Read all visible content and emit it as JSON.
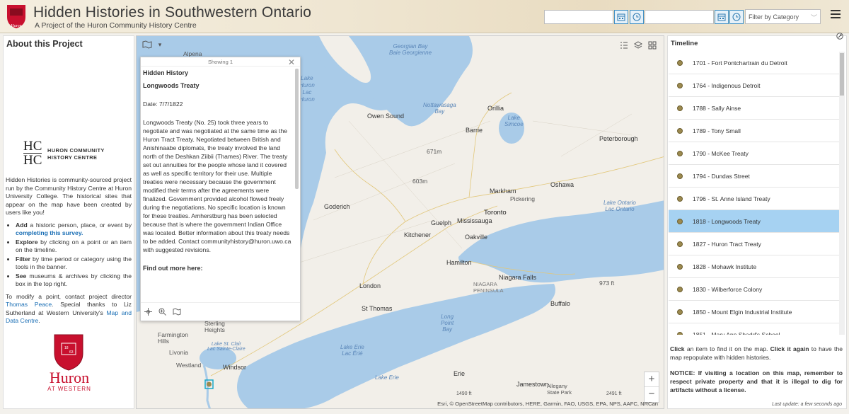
{
  "header": {
    "title": "Hidden Histories in Southwestern Ontario",
    "subtitle": "A Project of the Huron Community History Centre",
    "date_from_placeholder": "",
    "date_to_placeholder": "",
    "category_filter": "Filter by Category",
    "logo_text": "Huron",
    "accent": "#c8102e"
  },
  "about": {
    "title": "About this Project",
    "org_monogram_top": "HC",
    "org_monogram_bottom": "HC",
    "org_name_1": "HURON COMMUNITY",
    "org_name_2": "HISTORY CENTRE",
    "intro": "Hidden Histories is community-sourced project run by the Community History Centre at Huron University College. The historical sites that appear on the map have been created by users like you!",
    "bullets": [
      {
        "bold": "Add",
        "text": " a historic person, place, or event by ",
        "link": "completing this survey."
      },
      {
        "bold": "Explore",
        "text": " by clicking on a point or an item on the timeline.",
        "link": ""
      },
      {
        "bold": "Filter",
        "text": " by time period or category using the tools in the banner.",
        "link": ""
      },
      {
        "bold": "See",
        "text": " museums & archives by clicking the box in the top right.",
        "link": ""
      }
    ],
    "modify_pre": "To modify a point, contact project director ",
    "modify_link1": "Thomas Peace",
    "modify_mid": ". Special thanks to Liz Sutherland at Western University's ",
    "modify_link2": "Map and Data Centre",
    "modify_post": ".",
    "huron_word": "Huron",
    "at_western": "AT WESTERN",
    "shield_numbers": [
      "18",
      "63"
    ]
  },
  "popup": {
    "counter": "Showing 1",
    "layer_title": "Hidden History",
    "name": "Longwoods Treaty",
    "date_label": "Date:",
    "date_value": "7/7/1822",
    "description": "Longwoods Treaty (No. 25) took three years to negotiate and was negotiated at the same time as the Huron Tract Treaty. Negotiated between British and Anishinaabe diplomats, the treaty involved the land north of the Deshkan Ziibii (Thames) River. The treaty set out annuities for the people whose land it covered as well as specific territory for their use. Multiple treaties were necessary because the government modified their terms after the agreements were finalized. Government provided alcohol flowed freely during the negotiations. No specific location is known for these treaties. Amherstburg has been selected because that is where the government Indian Office was located. Better information about this treaty needs to be added. Contact communityhistory@huron.uwo.ca with suggested revisions.",
    "more": "Find out more here:"
  },
  "map": {
    "labels": {
      "alpena": "Alpena",
      "georgian_bay": "Georgian Bay\nBaie Georgienne",
      "lake_huron": "Lake\nHuron\nLac\nHuron",
      "owen_sound": "Owen Sound",
      "nottawasaga": "Nottawasaga\nBay",
      "orillia": "Orillia",
      "lake_simcoe": "Lake\nSimcoe",
      "barrie": "Barrie",
      "peterborough": "Peterborough",
      "markham": "Markham",
      "oshawa": "Oshawa",
      "pickering": "Pickering",
      "toronto": "Toronto",
      "lake_ontario": "Lake Ontario\nLac Ontario",
      "goderich": "Goderich",
      "guelph": "Guelph",
      "mississauga": "Mississauga",
      "kitchener": "Kitchener",
      "oakville": "Oakville",
      "hamilton": "Hamilton",
      "niagara_falls": "Niagara Falls",
      "niagara_peninsula": "NIAGARA\nPENINSULA",
      "london": "London",
      "st_thomas": "St Thomas",
      "buffalo": "Buffalo",
      "long_point_bay": "Long\nPoint\nBay",
      "sterling_heights": "Sterling\nHeights",
      "farmington_hills": "Farmington\nHills",
      "livonia": "Livonia",
      "westland": "Westland",
      "windsor": "Windsor",
      "lake_st_clair": "Lake St. Clair\nLac Sainte-Claire",
      "lake_erie": "Lake Erie\nLac Érié",
      "jamestown": "Jamestown",
      "allegany": "Allegany\nState Park",
      "erie": "Erie",
      "lake_erie2": "Lake Erie",
      "elev_671": "671m",
      "elev_603": "603m",
      "elev_973": "973 ft",
      "elev_1490": "1490 ft",
      "elev_2491": "2491 ft"
    },
    "attribution": "Esri, © OpenStreetMap contributors, HERE, Garmin, FAO, USGS, EPA, NPS, AAFC, NRCan",
    "zoom_in": "+",
    "zoom_out": "−",
    "water_color": "#a9cbe8",
    "land_color": "#f2efe9"
  },
  "timeline": {
    "title": "Timeline",
    "items": [
      {
        "label": "1701 - Fort Pontchartrain du Detroit",
        "selected": false
      },
      {
        "label": "1764 - Indigenous Detroit",
        "selected": false
      },
      {
        "label": "1788 - Sally Ainse",
        "selected": false
      },
      {
        "label": "1789 - Tony Small",
        "selected": false
      },
      {
        "label": "1790 - McKee Treaty",
        "selected": false
      },
      {
        "label": "1794 - Dundas Street",
        "selected": false
      },
      {
        "label": "1796 - St. Anne Island Treaty",
        "selected": false
      },
      {
        "label": "1818 - Longwoods Treaty",
        "selected": true
      },
      {
        "label": "1827 - Huron Tract Treaty",
        "selected": false
      },
      {
        "label": "1828 - Mohawk Institute",
        "selected": false
      },
      {
        "label": "1830 - Wilberforce Colony",
        "selected": false
      },
      {
        "label": "1850 - Mount Elgin Industrial Institute",
        "selected": false
      },
      {
        "label": "1851 - Mary Ann Shadd's School",
        "selected": false
      }
    ],
    "help_1a": "Click",
    "help_1b": " an item to find it on the map. ",
    "help_1c": "Click it again",
    "help_1d": " to have the map repopulate with hidden histories.",
    "notice": "NOTICE: If visiting a location on this map, remember to respect private property and that it is illegal to dig for artifacts without a license.",
    "updated": "Last update: a few seconds ago",
    "selected_color": "#a6d2f2"
  }
}
